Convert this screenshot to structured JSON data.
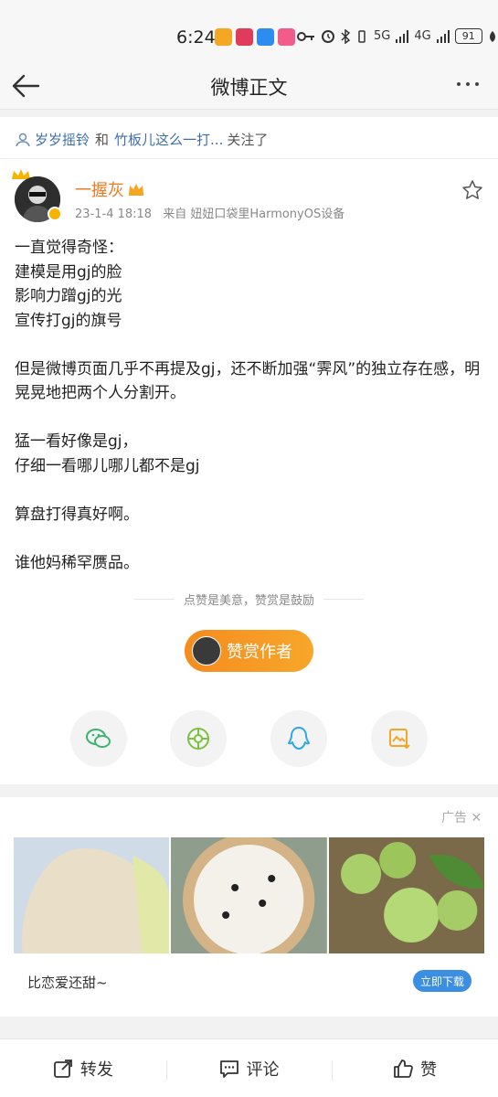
{
  "status": {
    "time": "6:24",
    "signal_1": "5G",
    "signal_2": "4G",
    "battery": "91"
  },
  "nav": {
    "title": "微博正文"
  },
  "follow": {
    "user1": "岁岁摇铃",
    "and": "和",
    "user2": "竹板儿这么一打...",
    "suffix": "关注了"
  },
  "post": {
    "author": "一握灰",
    "date": "23-1-4 18:18",
    "source": "来自 妞妞口袋里HarmonyOS设备",
    "lines": {
      "l1": "一直觉得奇怪：",
      "l2": "建模是用gj的脸",
      "l3": "影响力蹭gj的光",
      "l4": "宣传打gj的旗号",
      "l5": "但是微博页面几乎不再提及gj，还不断加强“霁风”的独立存在感，明晃晃地把两个人分割开。",
      "l6": "猛一看好像是gj，",
      "l7": "仔细一看哪儿哪儿都不是gj",
      "l8": "算盘打得真好啊。",
      "l9": "谁他妈稀罕赝品。"
    }
  },
  "reward": {
    "tip": "点赞是美意，赞赏是鼓励",
    "button": "赞赏作者"
  },
  "ad": {
    "tag": "广告",
    "caption": "比恋爱还甜~",
    "download": "立即下载"
  },
  "bottom_bar": {
    "repost": "转发",
    "comment": "评论",
    "like": "赞"
  },
  "colors": {
    "accent_orange": "#f07b1e",
    "link_blue": "#3c6fa8",
    "download_blue": "#3b8ee0"
  }
}
